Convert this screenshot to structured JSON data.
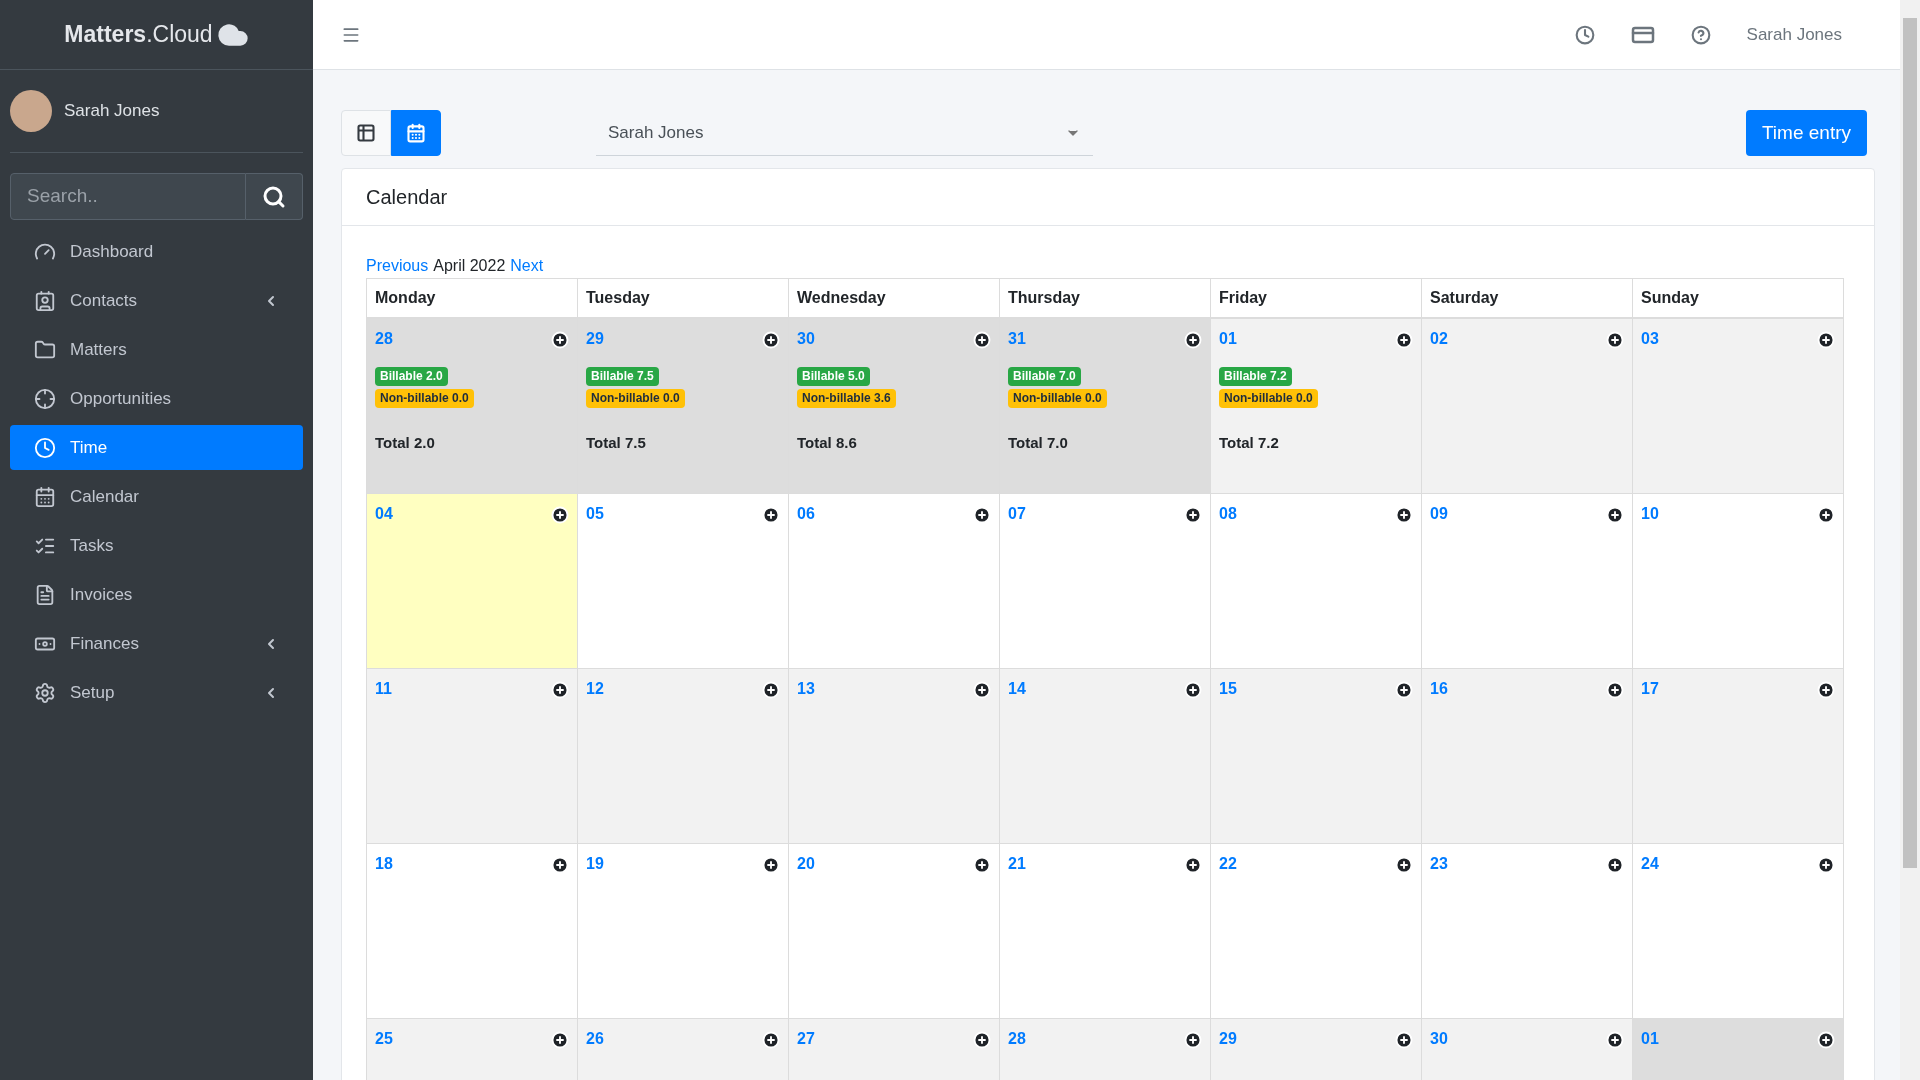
{
  "sidebar": {
    "brand": {
      "bold": "Matters",
      "light": ".Cloud"
    },
    "user": "Sarah Jones",
    "search": {
      "placeholder": "Search.."
    },
    "items": [
      {
        "label": "Dashboard",
        "selected": false,
        "submenu": false
      },
      {
        "label": "Contacts",
        "selected": false,
        "submenu": true
      },
      {
        "label": "Matters",
        "selected": false,
        "submenu": false
      },
      {
        "label": "Opportunities",
        "selected": false,
        "submenu": false
      },
      {
        "label": "Time",
        "selected": true,
        "submenu": false
      },
      {
        "label": "Calendar",
        "selected": false,
        "submenu": false
      },
      {
        "label": "Tasks",
        "selected": false,
        "submenu": false
      },
      {
        "label": "Invoices",
        "selected": false,
        "submenu": false
      },
      {
        "label": "Finances",
        "selected": false,
        "submenu": true
      },
      {
        "label": "Setup",
        "selected": false,
        "submenu": true
      }
    ]
  },
  "topbar": {
    "user": "Sarah Jones"
  },
  "toolbar": {
    "views": [
      {
        "kind": "table",
        "selected": false
      },
      {
        "kind": "calendar",
        "selected": true
      }
    ],
    "user_select": "Sarah Jones",
    "primary_button": "Time entry"
  },
  "calendar": {
    "title": "Calendar",
    "prev": "Previous",
    "month": "April 2022",
    "next": "Next",
    "columns": [
      "Monday",
      "Tuesday",
      "Wednesday",
      "Thursday",
      "Friday",
      "Saturday",
      "Sunday"
    ],
    "weeks": [
      [
        {
          "date": "28",
          "kind": "other",
          "billable": "Billable 2.0",
          "nonbillable": "Non-billable 0.0",
          "total": "Total 2.0"
        },
        {
          "date": "29",
          "kind": "other",
          "billable": "Billable 7.5",
          "nonbillable": "Non-billable 0.0",
          "total": "Total 7.5"
        },
        {
          "date": "30",
          "kind": "other",
          "billable": "Billable 5.0",
          "nonbillable": "Non-billable 3.6",
          "total": "Total 8.6"
        },
        {
          "date": "31",
          "kind": "other",
          "billable": "Billable 7.0",
          "nonbillable": "Non-billable 0.0",
          "total": "Total 7.0"
        },
        {
          "date": "01",
          "kind": "normal",
          "billable": "Billable 7.2",
          "nonbillable": "Non-billable 0.0",
          "total": "Total 7.2"
        },
        {
          "date": "02",
          "kind": "normal"
        },
        {
          "date": "03",
          "kind": "normal"
        }
      ],
      [
        {
          "date": "04",
          "kind": "today"
        },
        {
          "date": "05",
          "kind": "normal"
        },
        {
          "date": "06",
          "kind": "normal"
        },
        {
          "date": "07",
          "kind": "normal"
        },
        {
          "date": "08",
          "kind": "normal"
        },
        {
          "date": "09",
          "kind": "normal"
        },
        {
          "date": "10",
          "kind": "normal"
        }
      ],
      [
        {
          "date": "11",
          "kind": "normal"
        },
        {
          "date": "12",
          "kind": "normal"
        },
        {
          "date": "13",
          "kind": "normal"
        },
        {
          "date": "14",
          "kind": "normal"
        },
        {
          "date": "15",
          "kind": "normal"
        },
        {
          "date": "16",
          "kind": "normal"
        },
        {
          "date": "17",
          "kind": "normal"
        }
      ],
      [
        {
          "date": "18",
          "kind": "normal"
        },
        {
          "date": "19",
          "kind": "normal"
        },
        {
          "date": "20",
          "kind": "normal"
        },
        {
          "date": "21",
          "kind": "normal"
        },
        {
          "date": "22",
          "kind": "normal"
        },
        {
          "date": "23",
          "kind": "normal"
        },
        {
          "date": "24",
          "kind": "normal"
        }
      ],
      [
        {
          "date": "25",
          "kind": "normal"
        },
        {
          "date": "26",
          "kind": "normal"
        },
        {
          "date": "27",
          "kind": "normal"
        },
        {
          "date": "28",
          "kind": "normal"
        },
        {
          "date": "29",
          "kind": "normal"
        },
        {
          "date": "30",
          "kind": "normal"
        },
        {
          "date": "01",
          "kind": "other"
        }
      ]
    ]
  }
}
